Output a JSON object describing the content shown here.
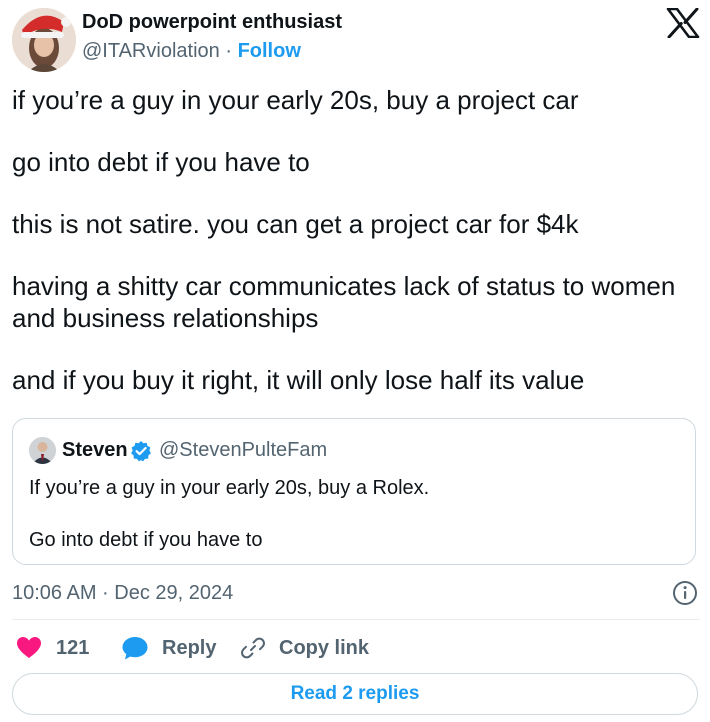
{
  "author": {
    "name": "DoD powerpoint enthusiast",
    "handle": "@ITARviolation",
    "separator": "·",
    "follow_label": "Follow"
  },
  "tweet": {
    "paragraphs": [
      "if you’re a guy in your early 20s, buy a project car",
      "go into debt if you have to",
      "this is not satire. you can get a project car for $4k",
      "having a shitty car communicates lack of status to women and business relationships",
      "and if you buy it right, it will only lose half its value"
    ]
  },
  "quote": {
    "name": "Steven",
    "handle": "@StevenPulteFam",
    "verified": true,
    "paragraphs": [
      "If you’re a guy in your early 20s, buy a Rolex.",
      "Go into debt if you have to"
    ]
  },
  "meta": {
    "timestamp": "10:06 AM · Dec 29, 2024"
  },
  "actions": {
    "like_count": "121",
    "reply_label": "Reply",
    "copy_link_label": "Copy link"
  },
  "footer": {
    "read_replies_label": "Read 2 replies"
  },
  "icons": {
    "platform_logo": "x-logo-icon",
    "verified": "verified-badge-icon",
    "info": "info-icon",
    "like": "heart-icon",
    "reply": "speech-bubble-icon",
    "copy_link": "link-icon"
  },
  "colors": {
    "accent": "#1d9bf0",
    "like": "#f91880",
    "text_primary": "#0f1419",
    "text_secondary": "#536471",
    "border": "#cfd9de"
  }
}
